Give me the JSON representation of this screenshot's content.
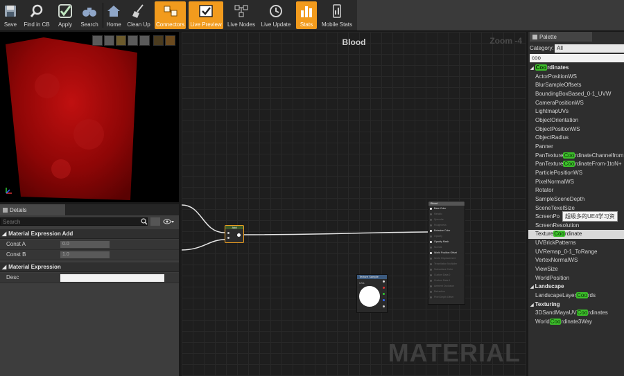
{
  "toolbar": {
    "buttons": [
      {
        "label": "Save",
        "icon": "floppy-disk-icon"
      },
      {
        "label": "Find in CB",
        "icon": "magnifier-icon"
      },
      {
        "label": "Apply",
        "icon": "checkmark-icon"
      },
      {
        "label": "Search",
        "icon": "binoculars-icon"
      },
      {
        "label": "Home",
        "icon": "home-icon"
      },
      {
        "label": "Clean Up",
        "icon": "broom-icon"
      },
      {
        "label": "Connectors",
        "icon": "connectors-icon"
      },
      {
        "label": "Live Preview",
        "icon": "live-preview-icon"
      },
      {
        "label": "Live Nodes",
        "icon": "live-nodes-icon"
      },
      {
        "label": "Live Update",
        "icon": "live-update-icon"
      },
      {
        "label": "Stats",
        "icon": "stats-icon"
      },
      {
        "label": "Mobile Stats",
        "icon": "mobile-stats-icon"
      }
    ],
    "accent": "#f29b1d"
  },
  "details": {
    "tab_label": "Details",
    "search_placeholder": "Search",
    "section1": "Material Expression Add",
    "const_a_label": "Const A",
    "const_a_value": "0.0",
    "const_b_label": "Const B",
    "const_b_value": "1.0",
    "section2": "Material Expression",
    "desc_label": "Desc",
    "desc_value": ""
  },
  "graph": {
    "title": "Blood",
    "zoom": "Zoom -4",
    "watermark": "MATERIAL",
    "add_node_title": "Add",
    "result_node_title": "Blood",
    "result_pins": [
      "Base Color",
      "Metallic",
      "Specular",
      "Roughness",
      "Emissive Color",
      "Opacity",
      "Opacity Mask",
      "Normal",
      "World Position Offset",
      "World Displacement",
      "Tessellation Multiplier",
      "Subsurface Color",
      "Custom Data 0",
      "Custom Data 1",
      "Ambient Occlusion",
      "Refraction",
      "Pixel Depth Offset"
    ],
    "texture_node_title": "Texture Sample",
    "texture_uvs_label": "UVs"
  },
  "palette": {
    "tab_label": "Palette",
    "category_label": "Category:",
    "category_value": "All",
    "search_value": "coo",
    "items": [
      {
        "type": "cat",
        "pre": "",
        "hl": "Coo",
        "post": "rdinates"
      },
      {
        "type": "item",
        "pre": "ActorPositionWS",
        "hl": "",
        "post": ""
      },
      {
        "type": "item",
        "pre": "BlurSampleOffsets",
        "hl": "",
        "post": ""
      },
      {
        "type": "item",
        "pre": "BoundingBoxBased_0-1_UVW",
        "hl": "",
        "post": ""
      },
      {
        "type": "item",
        "pre": "CameraPositionWS",
        "hl": "",
        "post": ""
      },
      {
        "type": "item",
        "pre": "LightmapUVs",
        "hl": "",
        "post": ""
      },
      {
        "type": "item",
        "pre": "ObjectOrientation",
        "hl": "",
        "post": ""
      },
      {
        "type": "item",
        "pre": "ObjectPositionWS",
        "hl": "",
        "post": ""
      },
      {
        "type": "item",
        "pre": "ObjectRadius",
        "hl": "",
        "post": ""
      },
      {
        "type": "item",
        "pre": "Panner",
        "hl": "",
        "post": ""
      },
      {
        "type": "item",
        "pre": "PanTexture",
        "hl": "Coo",
        "post": "rdinateChannelfrom"
      },
      {
        "type": "item",
        "pre": "PanTexture",
        "hl": "Coo",
        "post": "rdinateFrom-1toN+"
      },
      {
        "type": "item",
        "pre": "ParticlePositionWS",
        "hl": "",
        "post": ""
      },
      {
        "type": "item",
        "pre": "PixelNormalWS",
        "hl": "",
        "post": ""
      },
      {
        "type": "item",
        "pre": "Rotator",
        "hl": "",
        "post": ""
      },
      {
        "type": "item",
        "pre": "SampleSceneDepth",
        "hl": "",
        "post": ""
      },
      {
        "type": "item",
        "pre": "SceneTexelSize",
        "hl": "",
        "post": ""
      },
      {
        "type": "item",
        "pre": "ScreenPo",
        "hl": "",
        "post": ""
      },
      {
        "type": "item",
        "pre": "ScreenResolution",
        "hl": "",
        "post": ""
      },
      {
        "type": "sel",
        "pre": "Texture",
        "hl": "Coo",
        "post": "rdinate"
      },
      {
        "type": "item",
        "pre": "UVBrickPatterns",
        "hl": "",
        "post": ""
      },
      {
        "type": "item",
        "pre": "UVRemap_0-1_ToRange",
        "hl": "",
        "post": ""
      },
      {
        "type": "item",
        "pre": "VertexNormalWS",
        "hl": "",
        "post": ""
      },
      {
        "type": "item",
        "pre": "ViewSize",
        "hl": "",
        "post": ""
      },
      {
        "type": "item",
        "pre": "WorldPosition",
        "hl": "",
        "post": ""
      },
      {
        "type": "cat",
        "pre": "Landscape",
        "hl": "",
        "post": ""
      },
      {
        "type": "item",
        "pre": "LandscapeLayer",
        "hl": "Coo",
        "post": "rds"
      },
      {
        "type": "cat",
        "pre": "Texturing",
        "hl": "",
        "post": ""
      },
      {
        "type": "item",
        "pre": "3DSandMayaUV",
        "hl": "Coo",
        "post": "rdinates"
      },
      {
        "type": "item",
        "pre": "World",
        "hl": "Coo",
        "post": "rdinate3Way"
      }
    ],
    "tooltip": "超级多的UE4学习资"
  }
}
